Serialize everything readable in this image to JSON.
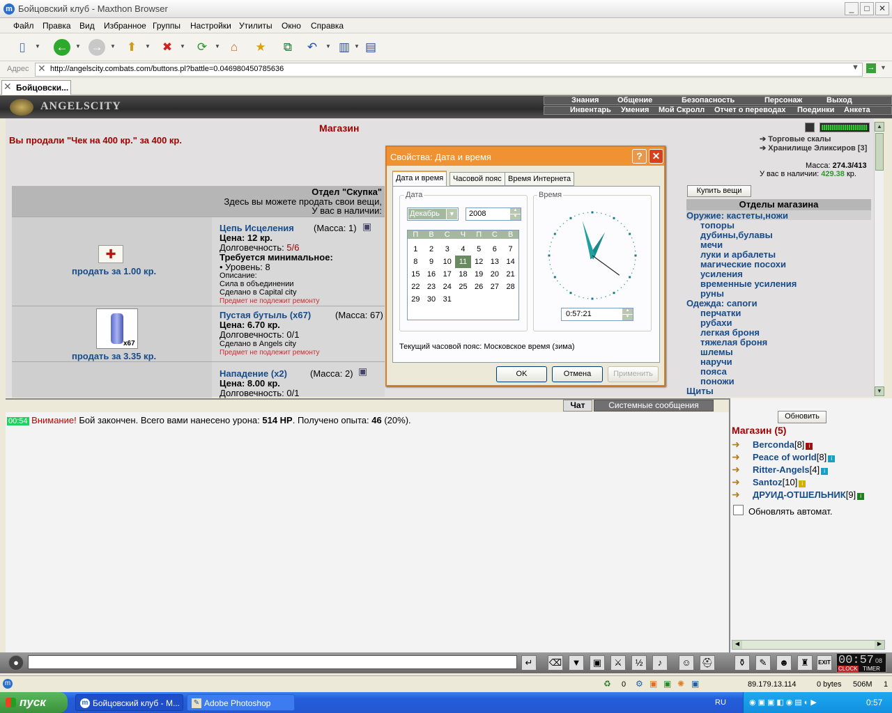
{
  "window": {
    "title": "Бойцовский клуб - Maxthon Browser",
    "min": "_",
    "max": "□",
    "close": "✕"
  },
  "menu": [
    "Файл",
    "Правка",
    "Вид",
    "Избранное",
    "Группы",
    "Настройки",
    "Утилиты",
    "Окно",
    "Справка"
  ],
  "address": {
    "label": "Адрес",
    "url": "http://angelscity.combats.com/buttons.pl?battle=0.046980450785636"
  },
  "tab": {
    "label": "Бойцовски..."
  },
  "game": {
    "logo": "ANGELSCITY",
    "nav_top": [
      "Знания",
      "Общение",
      "Безопасность",
      "Персонаж",
      "Выход"
    ],
    "nav_bottom": [
      "Инвентарь",
      "Умения",
      "Мой Скролл",
      "Отчет о переводах",
      "Поединки",
      "Анкета"
    ]
  },
  "shop": {
    "title": "Магазин",
    "sold_msg": "Вы продали \"Чек на 400 кр.\" за 400 кр.",
    "dept_title": "Отдел \"Скупка\"",
    "dept_sub": "Здесь вы можете продать свои вещи,",
    "dept_have": "У вас в наличии:",
    "items": [
      {
        "name": "Цепь Исцеления",
        "mass": "(Масса: 1)",
        "price": "Цена: 12 кр.",
        "durability_label": "Долговечность:",
        "durability": "5/6",
        "req": "Требуется минимальное:",
        "level": "• Уровень: 8",
        "desc": "Описание:",
        "desc2": "Сила в объединении",
        "made": "Сделано в Capital city",
        "norepair": "Предмет не подлежит ремонту",
        "sell": "продать за 1.00 кр."
      },
      {
        "name": "Пустая бутыль (x67)",
        "mass": "(Масса: 67)",
        "price": "Цена: 6.70 кр.",
        "durability": "Долговечность: 0/1",
        "made": "Сделано в Angels city",
        "norepair": "Предмет не подлежит ремонту",
        "sell": "продать за 3.35 кр.",
        "count": "x67"
      },
      {
        "name": "Нападение (x2)",
        "mass": "(Масса: 2)",
        "price": "Цена: 8.00 кр.",
        "durability": "Долговечность: 0/1"
      }
    ],
    "links": [
      "Торговые скалы",
      "Хранилище Эликсиров [3]"
    ],
    "mass_label": "Масса:",
    "mass_value": "274.3/413",
    "money_label": "У вас в наличии:",
    "money_value": "429.38",
    "money_unit": "кр.",
    "buy_button": "Купить вещи",
    "departments_title": "Отделы магазина",
    "departments": [
      {
        "label": "Оружие: кастеты,ножи",
        "type": "head",
        "selected": true
      },
      {
        "label": "топоры",
        "type": "sub"
      },
      {
        "label": "дубины,булавы",
        "type": "sub"
      },
      {
        "label": "мечи",
        "type": "sub"
      },
      {
        "label": "луки и арбалеты",
        "type": "sub"
      },
      {
        "label": "магические посохи",
        "type": "sub"
      },
      {
        "label": "усиления",
        "type": "sub"
      },
      {
        "label": "временные усиления",
        "type": "sub"
      },
      {
        "label": "руны",
        "type": "sub"
      },
      {
        "label": "Одежда: сапоги",
        "type": "head"
      },
      {
        "label": "перчатки",
        "type": "sub"
      },
      {
        "label": "рубахи",
        "type": "sub"
      },
      {
        "label": "легкая броня",
        "type": "sub"
      },
      {
        "label": "тяжелая броня",
        "type": "sub"
      },
      {
        "label": "шлемы",
        "type": "sub"
      },
      {
        "label": "наручи",
        "type": "sub"
      },
      {
        "label": "пояса",
        "type": "sub"
      },
      {
        "label": "поножи",
        "type": "sub"
      },
      {
        "label": "Щиты",
        "type": "head"
      }
    ]
  },
  "dialog": {
    "title": "Свойства: Дата и время",
    "help": "?",
    "close": "✕",
    "tabs": [
      "Дата и время",
      "Часовой пояс",
      "Время Интернета"
    ],
    "date_group": "Дата",
    "time_group": "Время",
    "month": "Декабрь",
    "year": "2008",
    "weekdays": [
      "П",
      "В",
      "С",
      "Ч",
      "П",
      "С",
      "В"
    ],
    "days": [
      [
        "",
        "",
        "",
        "",
        "",
        "",
        ""
      ],
      [
        "1",
        "2",
        "3",
        "4",
        "5",
        "6",
        "7"
      ],
      [
        "8",
        "9",
        "10",
        "11",
        "12",
        "13",
        "14"
      ],
      [
        "15",
        "16",
        "17",
        "18",
        "19",
        "20",
        "21"
      ],
      [
        "22",
        "23",
        "24",
        "25",
        "26",
        "27",
        "28"
      ],
      [
        "29",
        "30",
        "31",
        "",
        "",
        "",
        ""
      ]
    ],
    "selected_day": "11",
    "time": "0:57:21",
    "clock": {
      "hours": 0,
      "minutes": 57,
      "seconds": 21
    },
    "tz": "Текущий часовой пояс: Московское время (зима)",
    "ok": "OK",
    "cancel": "Отмена",
    "apply": "Применить"
  },
  "chat": {
    "tabs": [
      "Чат",
      "Системные сообщения"
    ],
    "time": "00:54",
    "warn": "Внимание!",
    "msg1": "Бой закончен. Всего вами нанесено урона:",
    "dmg": "514 HP",
    "msg2": ". Получено опыта:",
    "exp": "46",
    "pct": "(20%)."
  },
  "side": {
    "refresh": "Обновить",
    "room": "Магазин (5)",
    "users": [
      {
        "name": "Berconda",
        "level": "[8]",
        "badge": "#a01010"
      },
      {
        "name": "Peace of world",
        "level": "[8]",
        "badge": "#19a0c0"
      },
      {
        "name": "Ritter-Angels",
        "level": "[4]",
        "badge": "#19a0c0"
      },
      {
        "name": "Santoz",
        "level": "[10]",
        "badge": "#d0b000"
      },
      {
        "name": "ДРУИД-ОТШЕЛЬНИК",
        "level": "[9]",
        "badge": "#208020"
      }
    ],
    "auto": "Обновлять автомат."
  },
  "gamebar": {
    "clock": "00:57",
    "sec": "08",
    "clock_label": "CLOCK",
    "timer_label": "TIMER",
    "exit": "EXIT"
  },
  "status": {
    "count": "0",
    "ip": "89.179.13.114",
    "bytes": "0 bytes",
    "mem": "506M",
    "one": "1"
  },
  "taskbar": {
    "start": "пуск",
    "tasks": [
      "Бойцовский клуб - M...",
      "Adobe Photoshop"
    ],
    "lang": "RU",
    "clock": "0:57"
  }
}
